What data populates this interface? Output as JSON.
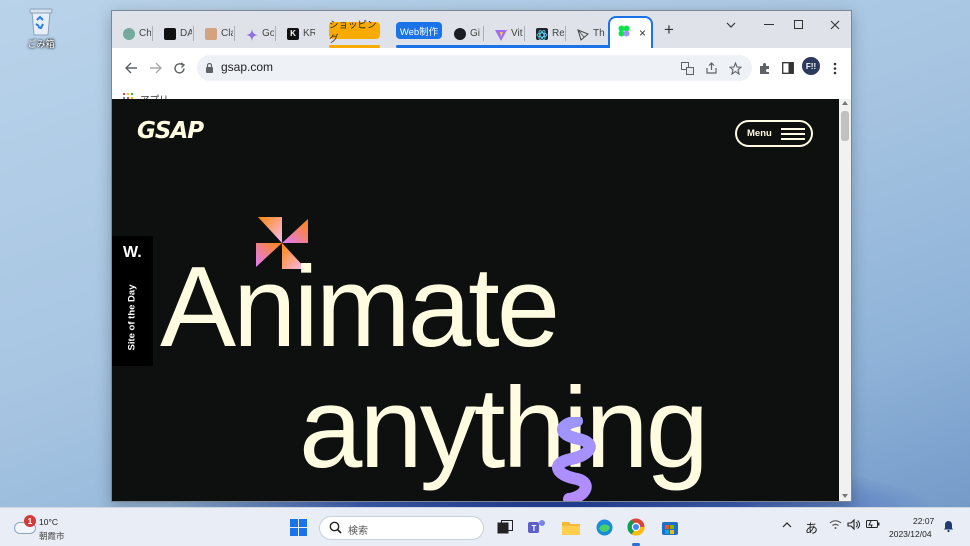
{
  "desktop": {
    "recycle_bin_label": "ごみ箱"
  },
  "browser": {
    "tabs": [
      {
        "label": "Ch",
        "favicon": "chatgpt-icon",
        "color": "#74aa9c"
      },
      {
        "label": "DA",
        "favicon": "openai-icon",
        "color": "#111111"
      },
      {
        "label": "Cla",
        "favicon": "anthropic-icon",
        "color": "#d4a27f"
      },
      {
        "label": "Go",
        "favicon": "gemini-icon",
        "color": "#8e6ee0"
      },
      {
        "label": "KR",
        "favicon": "k-icon",
        "color": "#111111"
      },
      {
        "label": "Gi",
        "favicon": "github-icon",
        "color": "#1b1f23"
      },
      {
        "label": "Vit",
        "favicon": "vite-icon",
        "color": "#a06cf5"
      },
      {
        "label": "Re",
        "favicon": "react-icon",
        "color": "#1f8fb5"
      },
      {
        "label": "Th",
        "favicon": "three-icon",
        "color": "#444444"
      }
    ],
    "tab_groups": [
      {
        "label": "ショッピング",
        "color": "#f9ab00"
      },
      {
        "label": "Web制作",
        "color": "#1a73e8"
      }
    ],
    "active_tab": {
      "favicon": "gsap-clover-icon",
      "close": "×"
    },
    "new_tab": "+",
    "url": "gsap.com",
    "bookmarks_label": "アプリ",
    "profile_label": "F!!"
  },
  "page": {
    "logo": "GSAP",
    "menu_label": "Menu",
    "sotd_w": "W.",
    "sotd_text": "Site of the Day",
    "hero_line1": "Animate",
    "hero_line2": "anything"
  },
  "taskbar": {
    "weather_badge": "1",
    "weather_temp": "10°C",
    "weather_city": "朝霞市",
    "search_placeholder": "検索",
    "ime": "あ",
    "time": "22:07",
    "date": "2023/12/04"
  }
}
